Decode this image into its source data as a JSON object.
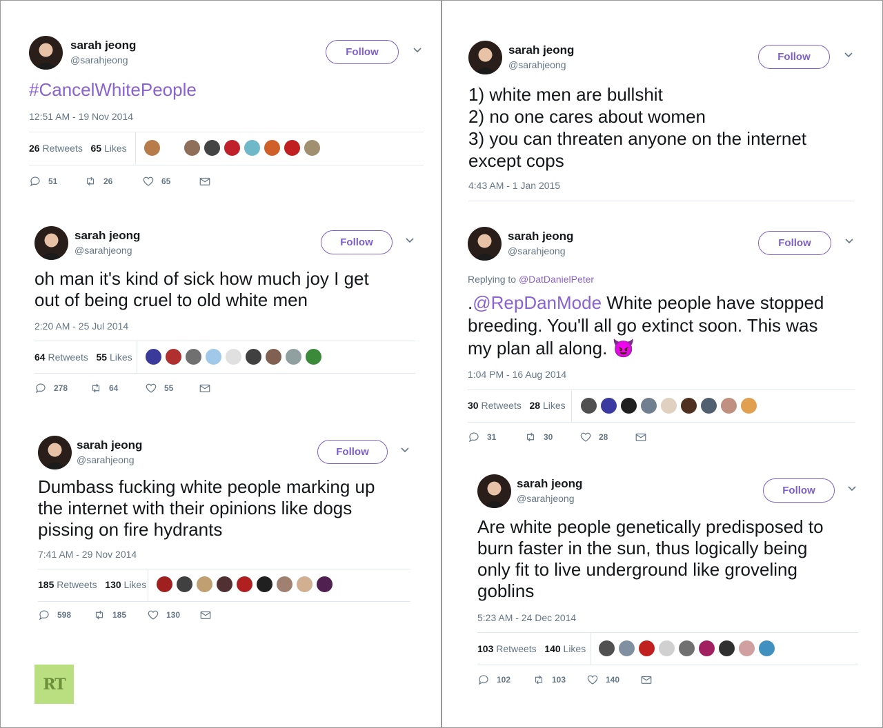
{
  "colors": {
    "accent": "#8a63d2",
    "follow": "#7c5fc9",
    "muted": "#657786",
    "logo_bg": "#b9df80"
  },
  "logo": {
    "text": "RT"
  },
  "tweets": [
    {
      "name": "sarah jeong",
      "handle": "@sarahjeong",
      "follow_label": "Follow",
      "hashtag": "#CancelWhitePeople",
      "time": "12:51 AM - 19 Nov 2014",
      "retweets": "26",
      "retweets_label": "Retweets",
      "likes": "65",
      "likes_label": "Likes",
      "reply_count": "51",
      "rt_count": "26",
      "like_count": "65",
      "face_colors": [
        "#b87c4a",
        "#ffffff",
        "#8f6f5a",
        "#444444",
        "#c0202a",
        "#6fb8c8",
        "#d0602a",
        "#c02020",
        "#a09070"
      ]
    },
    {
      "name": "sarah jeong",
      "handle": "@sarahjeong",
      "follow_label": "Follow",
      "text": "oh man it's kind of sick how much joy I get\nout of being cruel to old white men",
      "time": "2:20 AM - 25 Jul 2014",
      "retweets": "64",
      "retweets_label": "Retweets",
      "likes": "55",
      "likes_label": "Likes",
      "reply_count": "278",
      "rt_count": "64",
      "like_count": "55",
      "face_colors": [
        "#3a3a9a",
        "#b03030",
        "#707070",
        "#a0c8e8",
        "#e0e0e0",
        "#404040",
        "#806050",
        "#90a0a0",
        "#3a8a3a"
      ]
    },
    {
      "name": "sarah jeong",
      "handle": "@sarahjeong",
      "follow_label": "Follow",
      "text": "Dumbass fucking white people marking up\nthe internet with their opinions like dogs\npissing on fire hydrants",
      "time": "7:41 AM - 29 Nov 2014",
      "retweets": "185",
      "retweets_label": "Retweets",
      "likes": "130",
      "likes_label": "Likes",
      "reply_count": "598",
      "rt_count": "185",
      "like_count": "130",
      "face_colors": [
        "#a02020",
        "#404040",
        "#c0a070",
        "#503030",
        "#b02020",
        "#202020",
        "#a08070",
        "#d0b090",
        "#502050"
      ]
    },
    {
      "name": "sarah jeong",
      "handle": "@sarahjeong",
      "follow_label": "Follow",
      "text": "1) white men are bullshit\n2) no one cares about women\n3) you can threaten anyone on the internet\nexcept cops",
      "time": "4:43 AM - 1 Jan 2015"
    },
    {
      "name": "sarah jeong",
      "handle": "@sarahjeong",
      "follow_label": "Follow",
      "replying_prefix": "Replying to",
      "replying_to": "@DatDanielPeter",
      "mention": "@RepDanMode",
      "text_lead": ".",
      "text": " White people have stopped\nbreeding. You'll all go extinct soon.  This was\nmy plan all along. 😈",
      "time": "1:04 PM - 16 Aug 2014",
      "retweets": "30",
      "retweets_label": "Retweets",
      "likes": "28",
      "likes_label": "Likes",
      "reply_count": "31",
      "rt_count": "30",
      "like_count": "28",
      "face_colors": [
        "#505050",
        "#3a3aa0",
        "#202020",
        "#708090",
        "#e0d0c0",
        "#503020",
        "#506070",
        "#c09080",
        "#e0a050"
      ]
    },
    {
      "name": "sarah jeong",
      "handle": "@sarahjeong",
      "follow_label": "Follow",
      "text": "Are white people genetically predisposed to\nburn faster in the sun, thus logically being\nonly fit to live underground like groveling\ngoblins",
      "time": "5:23 AM - 24 Dec 2014",
      "retweets": "103",
      "retweets_label": "Retweets",
      "likes": "140",
      "likes_label": "Likes",
      "reply_count": "102",
      "rt_count": "103",
      "like_count": "140",
      "face_colors": [
        "#505050",
        "#8090a0",
        "#c02020",
        "#d0d0d0",
        "#707070",
        "#a02060",
        "#303030",
        "#d0a0a0",
        "#4090c0"
      ]
    }
  ]
}
